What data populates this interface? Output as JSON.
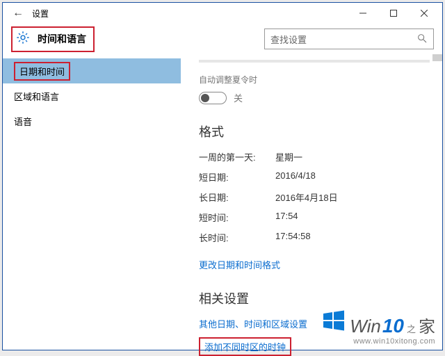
{
  "window": {
    "title": "设置",
    "search_placeholder": "查找设置"
  },
  "header": {
    "page_title": "时间和语言"
  },
  "sidebar": {
    "items": [
      {
        "label": "日期和时间"
      },
      {
        "label": "区域和语言"
      },
      {
        "label": "语音"
      }
    ]
  },
  "content": {
    "dst_label": "自动调整夏令时",
    "dst_state": "关",
    "format_header": "格式",
    "rows": [
      {
        "k": "一周的第一天:",
        "v": "星期一"
      },
      {
        "k": "短日期:",
        "v": "2016/4/18"
      },
      {
        "k": "长日期:",
        "v": "2016年4月18日"
      },
      {
        "k": "短时间:",
        "v": "17:54"
      },
      {
        "k": "长时间:",
        "v": "17:54:58"
      }
    ],
    "change_format_link": "更改日期和时间格式",
    "related_header": "相关设置",
    "other_link": "其他日期、时间和区域设置",
    "add_clocks_link": "添加不同时区的时钟"
  },
  "watermark": {
    "win": "Win",
    "ten": "10",
    "zhi": "之",
    "jia": "家",
    "url": "www.win10xitong.com"
  }
}
